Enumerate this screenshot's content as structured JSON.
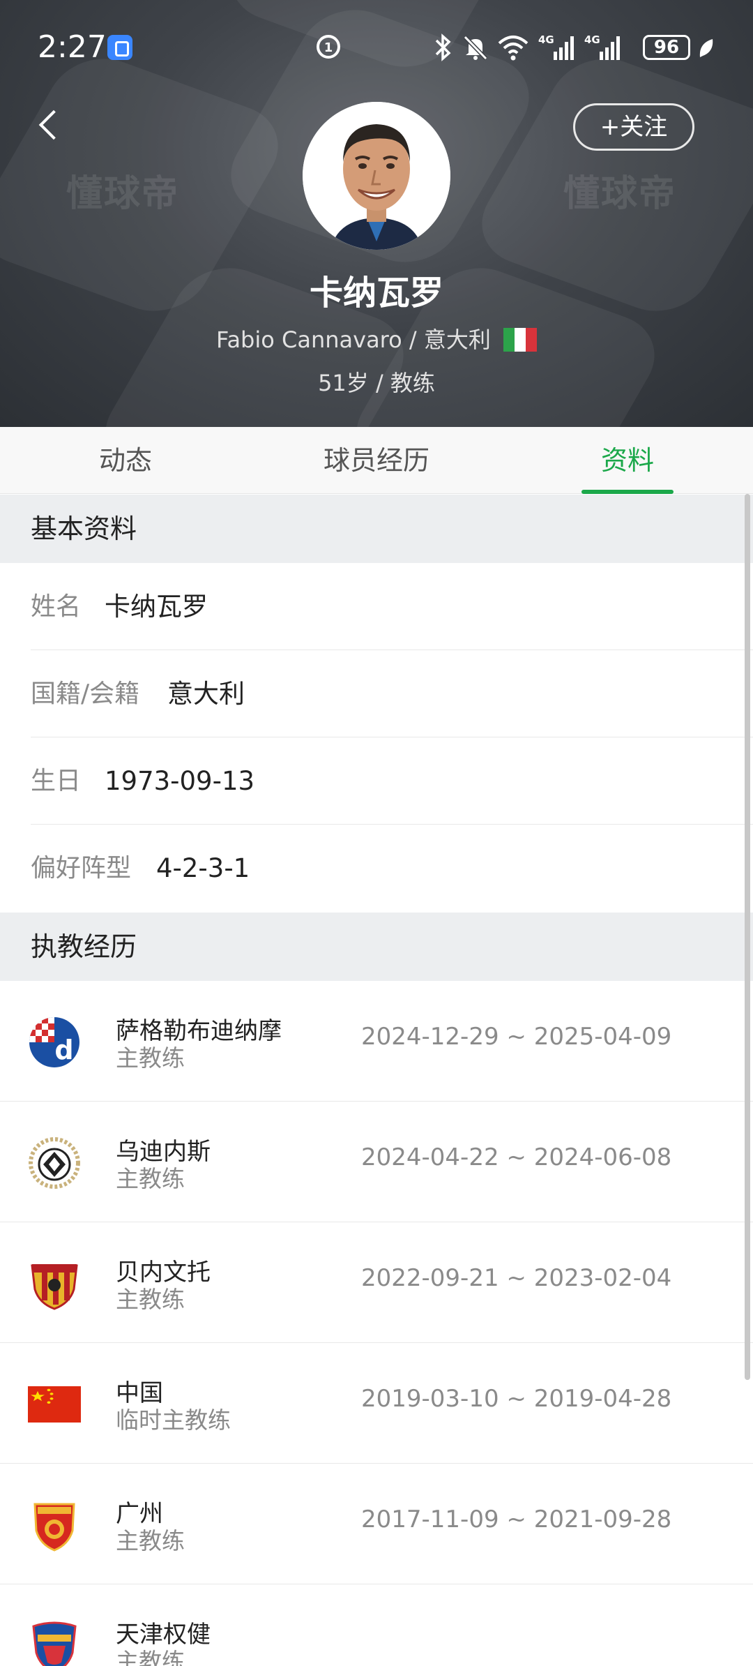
{
  "status_bar": {
    "time": "2:27",
    "battery": "96",
    "icons": [
      "app-badge-icon",
      "hd-icon",
      "bluetooth-icon",
      "mute-icon",
      "wifi-icon",
      "signal-4g-icon",
      "signal-4g-icon",
      "battery-icon",
      "leaf-icon"
    ]
  },
  "header": {
    "follow_label": "+关注",
    "watermark": "懂球帝",
    "name_cn": "卡纳瓦罗",
    "name_en_nationality": "Fabio Cannavaro / 意大利",
    "age_role": "51岁 / 教练"
  },
  "tabs": [
    {
      "label": "动态",
      "active": false
    },
    {
      "label": "球员经历",
      "active": false
    },
    {
      "label": "资料",
      "active": true
    }
  ],
  "basic_info": {
    "title": "基本资料",
    "rows": [
      {
        "label": "姓名",
        "value": "卡纳瓦罗"
      },
      {
        "label": "国籍/会籍",
        "value": "意大利"
      },
      {
        "label": "生日",
        "value": "1973-09-13"
      },
      {
        "label": "偏好阵型",
        "value": "4-2-3-1"
      }
    ]
  },
  "coaching": {
    "title": "执教经历",
    "rows": [
      {
        "club": "萨格勒布迪纳摩",
        "role": "主教练",
        "dates": "2024-12-29 ~ 2025-04-09",
        "logo": "dinamo-zagreb-logo-icon"
      },
      {
        "club": "乌迪内斯",
        "role": "主教练",
        "dates": "2024-04-22 ~ 2024-06-08",
        "logo": "udinese-logo-icon"
      },
      {
        "club": "贝内文托",
        "role": "主教练",
        "dates": "2022-09-21 ~ 2023-02-04",
        "logo": "benevento-logo-icon"
      },
      {
        "club": "中国",
        "role": "临时主教练",
        "dates": "2019-03-10 ~ 2019-04-28",
        "logo": "china-flag-icon"
      },
      {
        "club": "广州",
        "role": "主教练",
        "dates": "2017-11-09 ~ 2021-09-28",
        "logo": "guangzhou-logo-icon"
      },
      {
        "club": "天津权健",
        "role": "主教练",
        "dates": "",
        "logo": "tianjin-quanjian-logo-icon"
      }
    ]
  },
  "colors": {
    "accent_green": "#1ba84a",
    "header_dark": "#3f4349",
    "section_bg": "#eceef0"
  }
}
